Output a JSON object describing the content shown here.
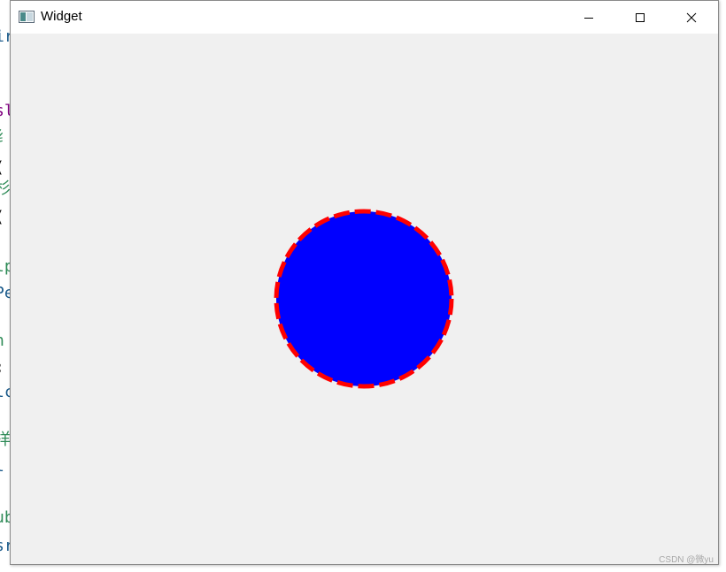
{
  "background_code": {
    "lines": [
      {
        "text": "ir",
        "color": "#1a5a8a"
      },
      {
        "text": "sl",
        "color": "#800080"
      },
      {
        "text": "纟",
        "color": "#2e8b57"
      },
      {
        "text": "(",
        "color": "#000000"
      },
      {
        "text": "杉",
        "color": "#2e8b57"
      },
      {
        "text": "(",
        "color": "#000000"
      },
      {
        "text": "lp",
        "color": "#2e8b57"
      },
      {
        "text": "Pe",
        "color": "#1a5a8a"
      },
      {
        "text": "h",
        "color": "#2e8b57"
      },
      {
        "text": ";",
        "color": "#000000"
      },
      {
        "text": "lc",
        "color": "#1a5a8a"
      },
      {
        "text": "样",
        "color": "#2e8b57"
      },
      {
        "text": "l",
        "color": "#1a5a8a"
      },
      {
        "text": "ub",
        "color": "#2e8b57"
      },
      {
        "text": "sr",
        "color": "#1a5a8a"
      }
    ]
  },
  "window": {
    "title": "Widget",
    "icon": "app-window-icon",
    "controls": {
      "minimize": "minimize-icon",
      "maximize": "maximize-icon",
      "close": "close-icon"
    }
  },
  "canvas": {
    "shape": "ellipse",
    "fill_color": "#0000ff",
    "stroke_color": "#ff0000",
    "stroke_style": "dashed",
    "background_color": "#f0f0f0"
  },
  "watermark": {
    "text": "CSDN @微yu"
  }
}
